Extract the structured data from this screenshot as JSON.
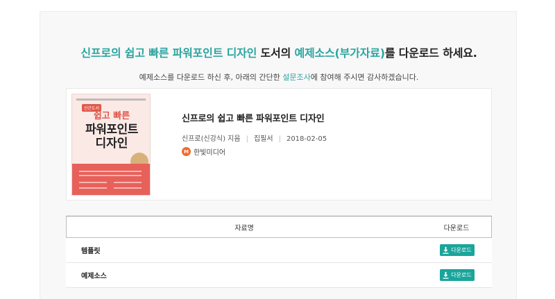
{
  "heading": {
    "title_accent": "신프로의 쉽고 빠른 파워포인트 디자인",
    "title_mid": " 도서의 ",
    "resources_accent": "예제소스(부가자료)",
    "title_end": "를 다운로드 하세요."
  },
  "subtext": {
    "before": "예제소스를 다운로드 하신 후, 아래의 간단한 ",
    "link": "설문조사",
    "after": "에 참여해 주시면 감사하겠습니다."
  },
  "book": {
    "title": "신프로의 쉽고 빠른 파워포인트 디자인",
    "author": "신프로(신강식) 지음",
    "format": "집필서",
    "date": "2018-02-05",
    "publisher": "한빛미디어",
    "publisher_logo_letter": "M",
    "cover": {
      "badge": "신간도서",
      "line1": "쉽고 빠른",
      "line2": "파워포인트",
      "line3": "디자인"
    }
  },
  "table": {
    "col_name": "자료명",
    "col_download": "다운로드",
    "rows": [
      {
        "name": "템플릿",
        "button": "다운로드"
      },
      {
        "name": "예제소스",
        "button": "다운로드"
      }
    ]
  },
  "colors": {
    "accent": "#2aa5a0",
    "button": "#1aa59b",
    "publisher_logo": "#f16a2e"
  }
}
